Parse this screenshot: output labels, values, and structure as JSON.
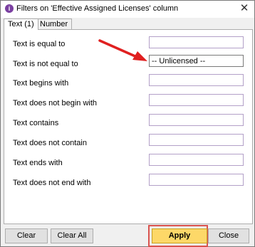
{
  "window": {
    "title": "Filters on 'Effective Assigned Licenses' column",
    "close_glyph": "✕"
  },
  "tabs": [
    {
      "label": "Text (1)",
      "active": true
    },
    {
      "label": "Number",
      "active": false
    }
  ],
  "filters": [
    {
      "label": "Text is equal to",
      "value": ""
    },
    {
      "label": "Text is not equal to",
      "value": "-- Unlicensed --"
    },
    {
      "label": "Text begins with",
      "value": ""
    },
    {
      "label": "Text does not begin with",
      "value": ""
    },
    {
      "label": "Text contains",
      "value": ""
    },
    {
      "label": "Text does not contain",
      "value": ""
    },
    {
      "label": "Text ends with",
      "value": ""
    },
    {
      "label": "Text does not end with",
      "value": ""
    }
  ],
  "buttons": {
    "clear": "Clear",
    "clear_all": "Clear All",
    "apply": "Apply",
    "close": "Close"
  },
  "colors": {
    "annotation_red": "#e02020",
    "apply_yellow": "#fdd868",
    "app_icon_purple": "#7a3fa0"
  }
}
